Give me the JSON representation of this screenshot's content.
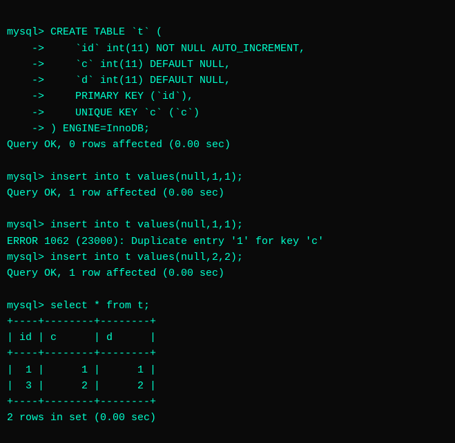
{
  "terminal": {
    "lines": [
      "mysql> CREATE TABLE `t` (",
      "    ->     `id` int(11) NOT NULL AUTO_INCREMENT,",
      "    ->     `c` int(11) DEFAULT NULL,",
      "    ->     `d` int(11) DEFAULT NULL,",
      "    ->     PRIMARY KEY (`id`),",
      "    ->     UNIQUE KEY `c` (`c`)",
      "    -> ) ENGINE=InnoDB;",
      "Query OK, 0 rows affected (0.00 sec)",
      "",
      "mysql> insert into t values(null,1,1);",
      "Query OK, 1 row affected (0.00 sec)",
      "",
      "mysql> insert into t values(null,1,1);",
      "ERROR 1062 (23000): Duplicate entry '1' for key 'c'",
      "mysql> insert into t values(null,2,2);",
      "Query OK, 1 row affected (0.00 sec)",
      "",
      "mysql> select * from t;",
      "+----+--------+--------+",
      "| id | c      | d      |",
      "+----+--------+--------+",
      "|  1 |      1 |      1 |",
      "|  3 |      2 |      2 |",
      "+----+--------+--------+",
      "2 rows in set (0.00 sec)"
    ]
  }
}
